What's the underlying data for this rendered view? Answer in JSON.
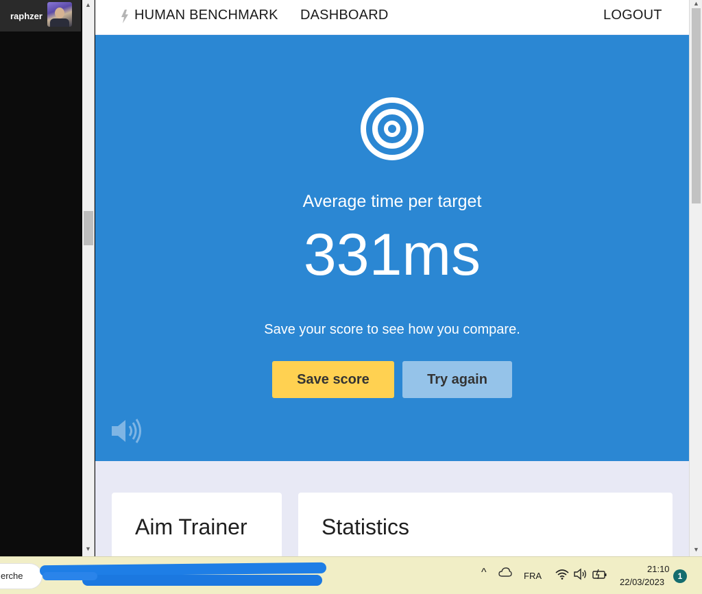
{
  "side_panel": {
    "user_name": "raphzer"
  },
  "nav": {
    "logo_icon": "lightning-bolt-icon",
    "brand": "HUMAN BENCHMARK",
    "dashboard": "DASHBOARD",
    "logout": "LOGOUT"
  },
  "hero": {
    "icon": "target-icon",
    "subtitle": "Average time per target",
    "score": "331ms",
    "note": "Save your score to see how you compare.",
    "save_label": "Save score",
    "retry_label": "Try again",
    "sound_icon": "speaker-icon"
  },
  "cards": [
    {
      "title": "Aim Trainer"
    },
    {
      "title": "Statistics"
    }
  ],
  "taskbar": {
    "search_text": "erche",
    "language": "FRA",
    "time": "21:10",
    "date": "22/03/2023",
    "notifications": "1"
  },
  "colors": {
    "hero_bg": "#2b87d3",
    "save_button": "#ffd151",
    "retry_button": "#95c3e9",
    "page_bg": "#e8e9f5",
    "taskbar_bg": "#f1eec6"
  }
}
